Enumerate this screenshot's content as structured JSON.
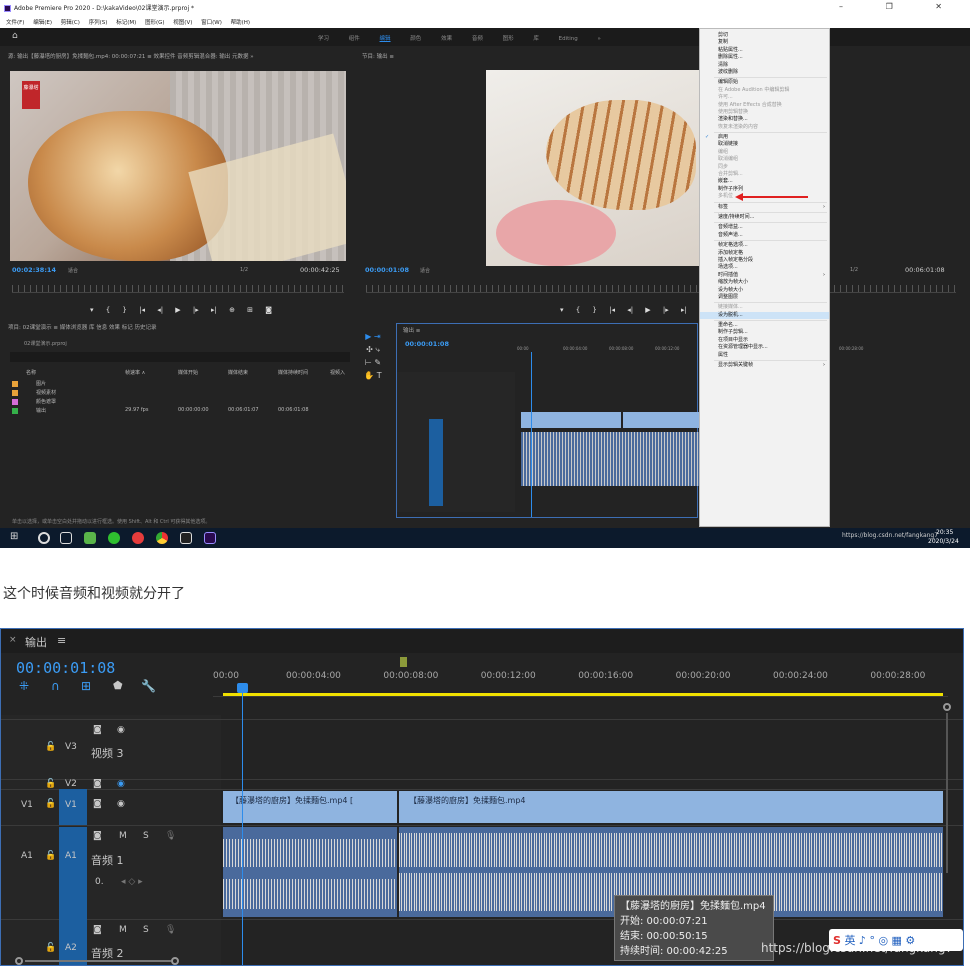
{
  "app": {
    "title": "Adobe Premiere Pro 2020 - D:\\kakaVideo\\02课堂演示.prproj *",
    "window_controls": "–  ❐  ✕",
    "menu": [
      "文件(F)",
      "编辑(E)",
      "剪辑(C)",
      "序列(S)",
      "标记(M)",
      "图形(G)",
      "视图(V)",
      "窗口(W)",
      "帮助(H)"
    ],
    "home": "⌂",
    "workspaces": [
      "学习",
      "组件",
      "编辑",
      "颜色",
      "效果",
      "音频",
      "图形",
      "库",
      "Editing",
      "»"
    ],
    "active_workspace_index": 2
  },
  "source_panel": {
    "tabs": "源: 输出【藤瀑塔的厨房】免揉麵包.mp4: 00:00:07:21  ≡     效果控件       音频剪辑混合器: 输出       元数据   »",
    "timecode": "00:02:38:14",
    "fit": "适合",
    "zoom": "1/2",
    "duration": "00:00:42:25",
    "logo": "藤瀑塔"
  },
  "program_panel": {
    "tab": "节目: 输出  ≡",
    "timecode": "00:00:01:08",
    "fit": "适合",
    "zoom": "1/2",
    "duration": "00:06:01:08"
  },
  "transport_glyphs": "▾  {  }  |◂  ◂|  ▶  |▸  ▸|  ⊕  ⊞  ◙",
  "project_panel": {
    "tabs": "项目: 02课堂演示  ≡    媒体浏览器    库    信息    效果    标记    历史记录",
    "project_file": "02课堂演示.prproj",
    "columns": [
      "名称",
      "帧速率 ∧",
      "媒体开始",
      "媒体结束",
      "媒体持续时间",
      "视频入"
    ],
    "rows": [
      {
        "name": "图片",
        "color": "#e8a23a",
        "fps": "",
        "start": "",
        "end": "",
        "dur": ""
      },
      {
        "name": "视频素材",
        "color": "#e8a23a",
        "fps": "",
        "start": "",
        "end": "",
        "dur": ""
      },
      {
        "name": "颜色遮罩",
        "color": "#d36dd6",
        "fps": "",
        "start": "",
        "end": "",
        "dur": ""
      },
      {
        "name": "输出",
        "color": "#35b04a",
        "fps": "29.97 fps",
        "start": "00:00:00:00",
        "end": "00:06:01:07",
        "dur": "00:06:01:08"
      }
    ],
    "status": "单击以选择，或单击空白处并拖动以进行框选。使用 Shift、Alt 和 Ctrl 可获得其他选项。"
  },
  "mini_timeline": {
    "tab": "输出  ≡",
    "timecode": "00:00:01:08",
    "ruler": [
      "00:00",
      "00:00:04:00",
      "00:00:08:00",
      "00:00:12:00",
      "00:00:16:00",
      "00:00:20:00",
      "00:00:24:00",
      "00:00:28:00"
    ]
  },
  "context_menu": [
    {
      "label": "剪切",
      "state": "normal"
    },
    {
      "label": "复制",
      "state": "normal"
    },
    {
      "label": "粘贴属性...",
      "state": "normal"
    },
    {
      "label": "删除属性...",
      "state": "normal"
    },
    {
      "label": "清除",
      "state": "normal"
    },
    {
      "label": "波纹删除",
      "state": "normal"
    },
    {
      "label": "",
      "state": "sep"
    },
    {
      "label": "编辑原始",
      "state": "normal"
    },
    {
      "label": "在 Adobe Audition 中编辑剪辑",
      "state": "dis"
    },
    {
      "label": "许可...",
      "state": "dis"
    },
    {
      "label": "使用 After Effects 合成替换",
      "state": "dis"
    },
    {
      "label": "使用剪辑替换",
      "state": "dis"
    },
    {
      "label": "渲染和替换...",
      "state": "normal"
    },
    {
      "label": "恢复未渲染的内容",
      "state": "dis"
    },
    {
      "label": "",
      "state": "sep"
    },
    {
      "label": "启用",
      "state": "chk"
    },
    {
      "label": "取消链接",
      "state": "normal"
    },
    {
      "label": "编组",
      "state": "dis"
    },
    {
      "label": "取消编组",
      "state": "dis"
    },
    {
      "label": "同步",
      "state": "dis"
    },
    {
      "label": "合并剪辑...",
      "state": "dis"
    },
    {
      "label": "嵌套...",
      "state": "normal"
    },
    {
      "label": "制作子序列",
      "state": "normal"
    },
    {
      "label": "多机位",
      "state": "dis"
    },
    {
      "label": "",
      "state": "sep"
    },
    {
      "label": "标签",
      "state": "arrow"
    },
    {
      "label": "",
      "state": "sep"
    },
    {
      "label": "速度/持续时间...",
      "state": "normal"
    },
    {
      "label": "",
      "state": "sep"
    },
    {
      "label": "音频增益...",
      "state": "normal"
    },
    {
      "label": "音频声道...",
      "state": "normal"
    },
    {
      "label": "",
      "state": "sep"
    },
    {
      "label": "帧定格选项...",
      "state": "normal"
    },
    {
      "label": "添加帧定格",
      "state": "normal"
    },
    {
      "label": "插入帧定格分段",
      "state": "normal"
    },
    {
      "label": "场选项...",
      "state": "normal"
    },
    {
      "label": "时间插值",
      "state": "arrow"
    },
    {
      "label": "缩放为帧大小",
      "state": "normal"
    },
    {
      "label": "设为帧大小",
      "state": "normal"
    },
    {
      "label": "调整图层",
      "state": "normal"
    },
    {
      "label": "",
      "state": "sep"
    },
    {
      "label": "链接媒体...",
      "state": "dis"
    },
    {
      "label": "设为脱机...",
      "state": "hl"
    },
    {
      "label": "",
      "state": "sep"
    },
    {
      "label": "重命名...",
      "state": "normal"
    },
    {
      "label": "制作子剪辑...",
      "state": "normal"
    },
    {
      "label": "在项目中显示",
      "state": "normal"
    },
    {
      "label": "在资源管理器中显示...",
      "state": "normal"
    },
    {
      "label": "属性",
      "state": "normal"
    },
    {
      "label": "",
      "state": "sep"
    },
    {
      "label": "显示剪辑关键帧",
      "state": "arrow"
    }
  ],
  "taskbar": {
    "time": "20:35",
    "date": "2020/3/24",
    "watermark": "https://blog.csdn.net/fangkang7"
  },
  "caption": "这个时候音频和视频就分开了",
  "timeline": {
    "tab": "输出",
    "menu_glyph": "≡",
    "close_glyph": "×",
    "timecode": "00:00:01:08",
    "ruler": [
      "00:00",
      "00:00:04:00",
      "00:00:08:00",
      "00:00:12:00",
      "00:00:16:00",
      "00:00:20:00",
      "00:00:24:00",
      "00:00:28:00"
    ],
    "tracks": {
      "v3": {
        "label": "V3",
        "name": "视频 3"
      },
      "v2": {
        "label": "V2"
      },
      "v1": {
        "src": "V1",
        "label": "V1"
      },
      "a1": {
        "src": "A1",
        "label": "A1",
        "name": "音频 1",
        "vol": "0.",
        "m": "M",
        "s": "S"
      },
      "a2": {
        "label": "A2",
        "name": "音频 2",
        "m": "M",
        "s": "S"
      }
    },
    "clips": {
      "video_1": "【藤瀑塔的廚房】免揉麵包.mp4 [",
      "video_2": "【藤瀑塔的廚房】免揉麵包.mp4"
    },
    "tooltip": {
      "title": "【藤瀑塔的廚房】免揉麵包.mp4",
      "start": "开始: 00:00:07:21",
      "end": "结束: 00:00:50:15",
      "duration": "持续时间: 00:00:42:25"
    },
    "watermark": "https://blog.csdn.net/fangkang7",
    "ime": "英 ♪ ° ◎ ▦ ⚙"
  },
  "colors": {
    "accent": "#2d8ceb",
    "timecode": "#3b9cf5",
    "clip_video": "#8fb4e0",
    "clip_audio": "#4a6a9c",
    "track_target": "#1c5fa0",
    "playhead": "#2d8ceb",
    "highlight": "#cde3f7"
  }
}
